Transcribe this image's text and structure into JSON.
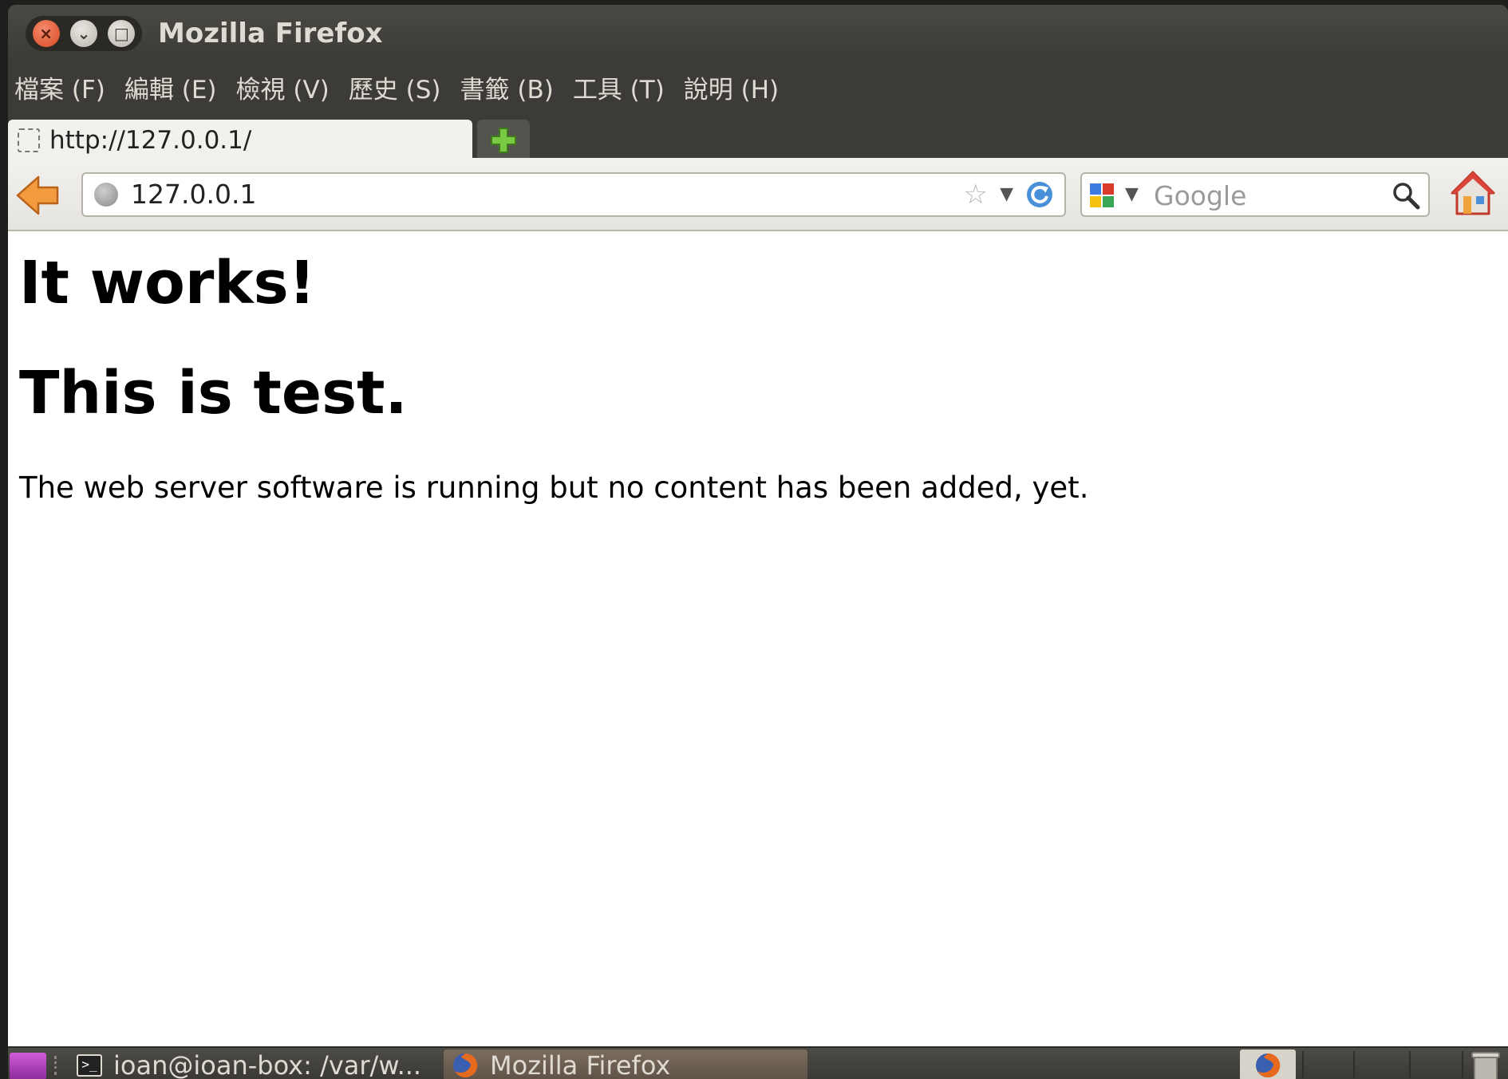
{
  "window": {
    "title": "Mozilla Firefox",
    "close_glyph": "×",
    "minimize_glyph": "⌄",
    "maximize_glyph": "□"
  },
  "menubar": {
    "items": [
      {
        "label": "檔案 (F)"
      },
      {
        "label": "編輯 (E)"
      },
      {
        "label": "檢視 (V)"
      },
      {
        "label": "歷史 (S)"
      },
      {
        "label": "書籤 (B)"
      },
      {
        "label": "工具 (T)"
      },
      {
        "label": "說明 (H)"
      }
    ]
  },
  "tabs": [
    {
      "label": "http://127.0.0.1/",
      "active": true
    }
  ],
  "navbar": {
    "url": "127.0.0.1",
    "search_placeholder": "Google",
    "icons": [
      "back-arrow-icon",
      "globe-icon",
      "star-icon",
      "reload-icon",
      "google-icon",
      "magnifier-icon",
      "home-icon"
    ]
  },
  "page": {
    "heading1": "It works!",
    "heading2": "This is test.",
    "paragraph": "The web server software is running but no content has been added, yet."
  },
  "taskbar": {
    "tasks": [
      {
        "label": "ioan@ioan-box: /var/w...",
        "icon": "terminal-icon"
      },
      {
        "label": "Mozilla Firefox",
        "icon": "firefox-icon",
        "active": true
      }
    ]
  },
  "colors": {
    "titlebar_bg": "#3c3b37",
    "title_text": "#dfdbd2",
    "close_button": "#d6491e",
    "content_bg": "#ffffff"
  }
}
